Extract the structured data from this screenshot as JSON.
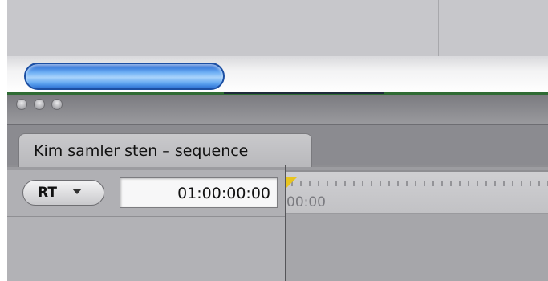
{
  "timeline": {
    "tab_label": "Kim samler sten – sequence",
    "rt_label": "RT",
    "timecode": "01:00:00:00",
    "ruler_label": "00:00"
  },
  "icons": {
    "close": "close-icon",
    "minimize": "minimize-icon",
    "zoom": "zoom-icon",
    "rt_menu_arrow": "chevron-down-icon",
    "playhead": "playhead-icon"
  },
  "colors": {
    "scroll_thumb": "#5ea4f0",
    "playhead": "#e8c41e",
    "window_bg": "#8e8e92"
  }
}
